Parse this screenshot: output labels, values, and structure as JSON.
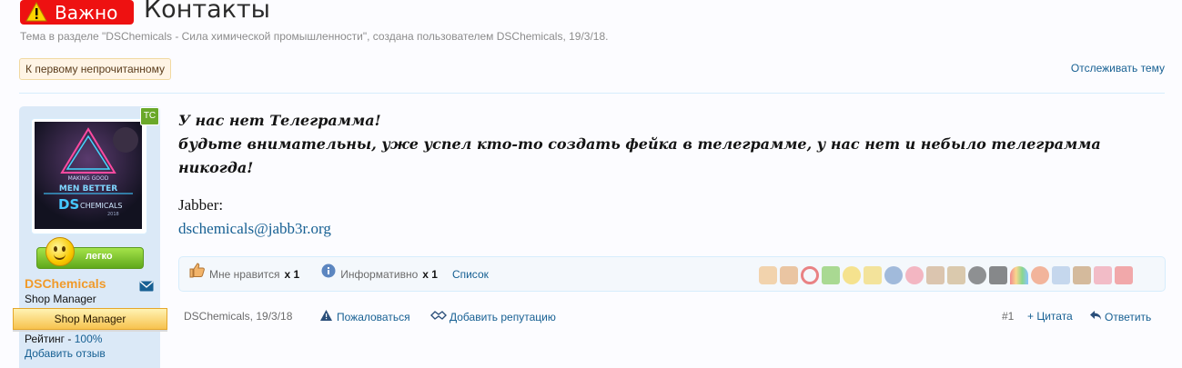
{
  "header": {
    "badge": "Важно",
    "title": "Контакты",
    "meta": "Тема в разделе \"DSChemicals - Сила химической промышленности\", создана пользователем DSChemicals, 19/3/18.",
    "first_unread": "К первому непрочитанному",
    "watch": "Отслеживать тему"
  },
  "user": {
    "tc_badge": "ТС",
    "mood": "легко",
    "name": "DSChemicals",
    "title": "Shop Manager",
    "ribbon": "Shop Manager",
    "rating_label": "Рейтинг - ",
    "rating_value": "100%",
    "add_review": "Добавить отзыв",
    "avatar_lines": [
      "MAKING GOOD",
      "MEN BETTER",
      "DS",
      "CHEMICALS",
      "2018"
    ]
  },
  "message": {
    "line1": "У нас нет Телеграмма!",
    "line2": "будьте внимательны, уже успел кто-то создать фейка в телеграмме, у нас нет и небыло телеграмма никогда!",
    "jabber_label": "Jabber:",
    "email": "dschemicals@jabb3r.org"
  },
  "likes": {
    "like_label": "Мне нравится",
    "like_count": "x 1",
    "info_label": "Информативно",
    "info_count": "x 1",
    "list": "Список"
  },
  "footer": {
    "author_date": "DSChemicals, 19/3/18",
    "report": "Пожаловаться",
    "add_rep": "Добавить репутацию",
    "post_no": "#1",
    "quote": "+ Цитата",
    "reply": "Ответить"
  },
  "colors": {
    "accent": "#176093",
    "username": "#f09a2a",
    "badge": "#ee1111"
  }
}
